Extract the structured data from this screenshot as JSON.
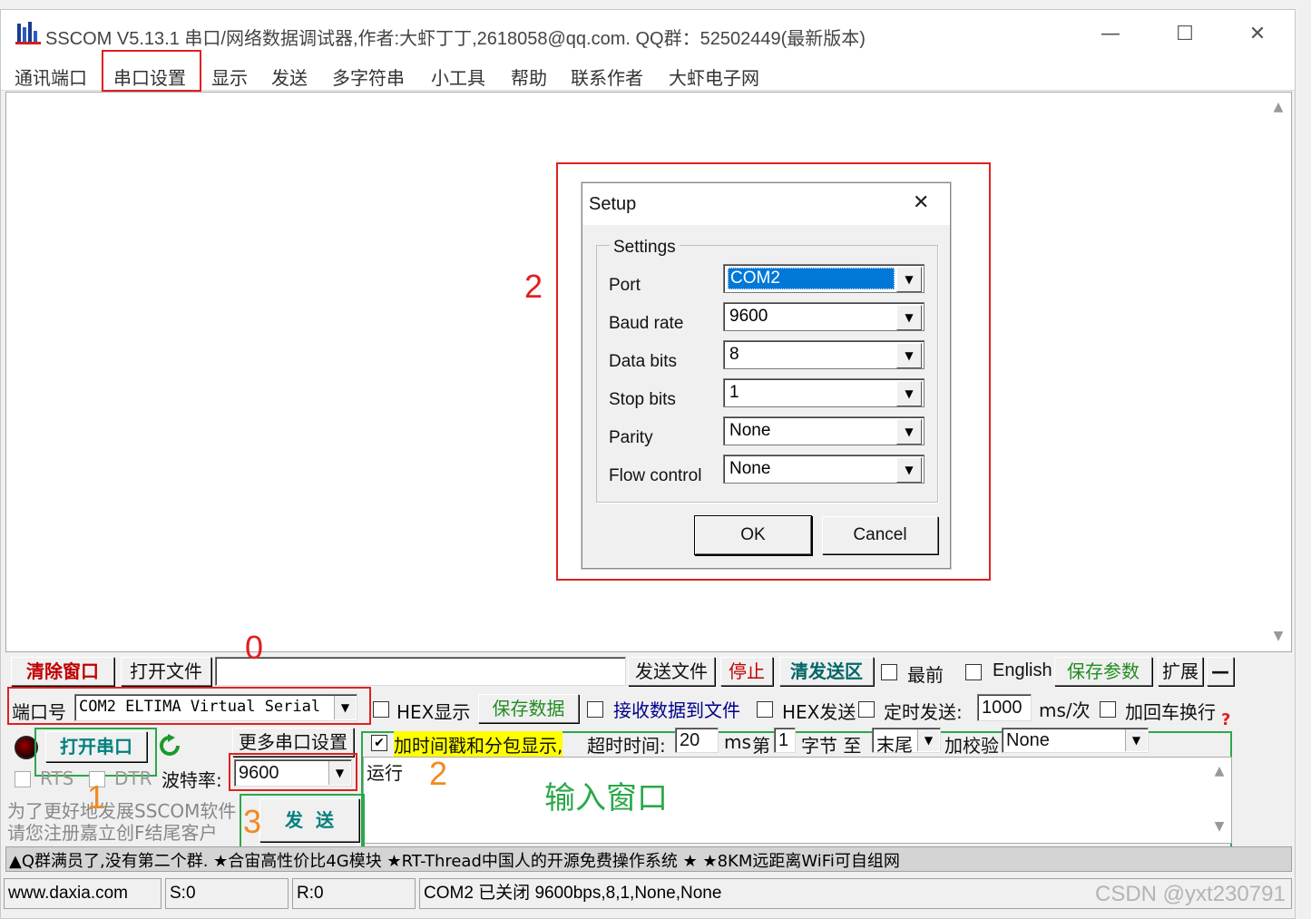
{
  "window": {
    "title": "SSCOM V5.13.1 串口/网络数据调试器,作者:大虾丁丁,2618058@qq.com. QQ群：52502449(最新版本)",
    "minimize": "—",
    "maximize": "☐",
    "close": "✕"
  },
  "menu": [
    "通讯端口",
    "串口设置",
    "显示",
    "发送",
    "多字符串",
    "小工具",
    "帮助",
    "联系作者",
    "大虾电子网"
  ],
  "dialog": {
    "title": "Setup",
    "close": "✕",
    "group_label": "Settings",
    "fields": [
      {
        "label": "Port",
        "value": "COM2"
      },
      {
        "label": "Baud rate",
        "value": "9600"
      },
      {
        "label": "Data bits",
        "value": "8"
      },
      {
        "label": "Stop bits",
        "value": "1"
      },
      {
        "label": "Parity",
        "value": "None"
      },
      {
        "label": "Flow control",
        "value": "None"
      }
    ],
    "ok": "OK",
    "cancel": "Cancel"
  },
  "toolbar1": {
    "clear": "清除窗口",
    "open_file": "打开文件",
    "send_file": "发送文件",
    "stop": "停止",
    "clear_send": "清发送区",
    "topmost": "最前",
    "english": "English",
    "save_params": "保存参数",
    "expand": "扩展",
    "collapse": "—"
  },
  "toolbar2": {
    "port_label": "端口号",
    "port_value": "COM2 ELTIMA Virtual Serial",
    "hex_display": "HEX显示",
    "save_data": "保存数据",
    "recv_to_file": "接收数据到文件",
    "hex_send": "HEX发送",
    "timed_send": "定时发送:",
    "interval": "1000",
    "interval_unit": "ms/次",
    "add_crlf": "加回车换行"
  },
  "toolbar3": {
    "open_port": "打开串口",
    "more_settings": "更多串口设置",
    "timestamp": "加时间戳和分包显示,",
    "timeout_label": "超时时间:",
    "timeout_value": "20",
    "timeout_unit": "ms",
    "nth_label": "第",
    "nth_value": "1",
    "byte_label": "字节 至",
    "end_value": "末尾",
    "checksum_label": "加校验",
    "checksum_value": "None"
  },
  "toolbar4": {
    "rts": "RTS",
    "dtr": "DTR",
    "baud_label": "波特率:",
    "baud_value": "9600",
    "input_text": "运行",
    "promo_line1": "为了更好地发展SSCOM软件",
    "promo_line2": "请您注册嘉立创F结尾客户",
    "send": "发  送"
  },
  "ticker": "▲Q群满员了,没有第二个群. ★合宙高性价比4G模块 ★RT-Thread中国人的开源免费操作系统 ★ ★8KM远距离WiFi可自组网",
  "status": {
    "site": "www.daxia.com",
    "sent": "S:0",
    "received": "R:0",
    "port_state": "COM2 已关闭  9600bps,8,1,None,None"
  },
  "annotations": {
    "red_1": "1",
    "red_2": "2",
    "red_0": "0",
    "orange_1": "1",
    "orange_2": "2",
    "orange_3": "3",
    "input_window": "输入窗口"
  },
  "watermark": "CSDN @yxt230791",
  "colors": {
    "annotation_red": "#e02020",
    "annotation_green": "#2aa84a",
    "annotation_orange": "#f08a24",
    "highlight_yellow": "#ffff00",
    "selection_blue": "#0078d7"
  }
}
